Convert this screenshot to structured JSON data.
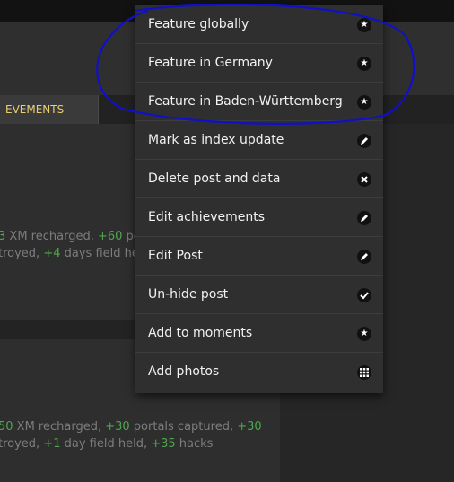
{
  "tabs": {
    "achievements_label": "EVEMENTS"
  },
  "stats_card1": {
    "line1": {
      "pre": "3",
      "text1": " XM recharged, ",
      "g2": "+60",
      "text2": " po"
    },
    "line2": {
      "text0": "troyed, ",
      "g1": "+4",
      "text1": " days field held, "
    }
  },
  "stats_card2": {
    "line1": {
      "pre": "50",
      "text1": " XM recharged, ",
      "g2": "+30",
      "text2": " portals captured, ",
      "g3": "+30"
    },
    "line2": {
      "text0": "troyed, ",
      "g1": "+1",
      "text1": " day field held, ",
      "g2": "+35",
      "text2": " hacks"
    }
  },
  "menu": {
    "items": [
      {
        "label": "Feature globally",
        "icon": "star-icon"
      },
      {
        "label": "Feature in Germany",
        "icon": "star-icon"
      },
      {
        "label": "Feature in Baden-Württemberg",
        "icon": "star-icon"
      },
      {
        "label": "Mark as index update",
        "icon": "pencil-icon"
      },
      {
        "label": "Delete post and data",
        "icon": "close-icon"
      },
      {
        "label": "Edit achievements",
        "icon": "pencil-icon"
      },
      {
        "label": "Edit Post",
        "icon": "pencil-icon"
      },
      {
        "label": "Un-hide post",
        "icon": "check-icon"
      },
      {
        "label": "Add to moments",
        "icon": "star-icon"
      },
      {
        "label": "Add photos",
        "icon": "grid-icon"
      }
    ]
  },
  "colors": {
    "highlight_ink": "#1010c8",
    "accent_gold": "#e8cf73",
    "stat_green": "#4ea64e"
  }
}
